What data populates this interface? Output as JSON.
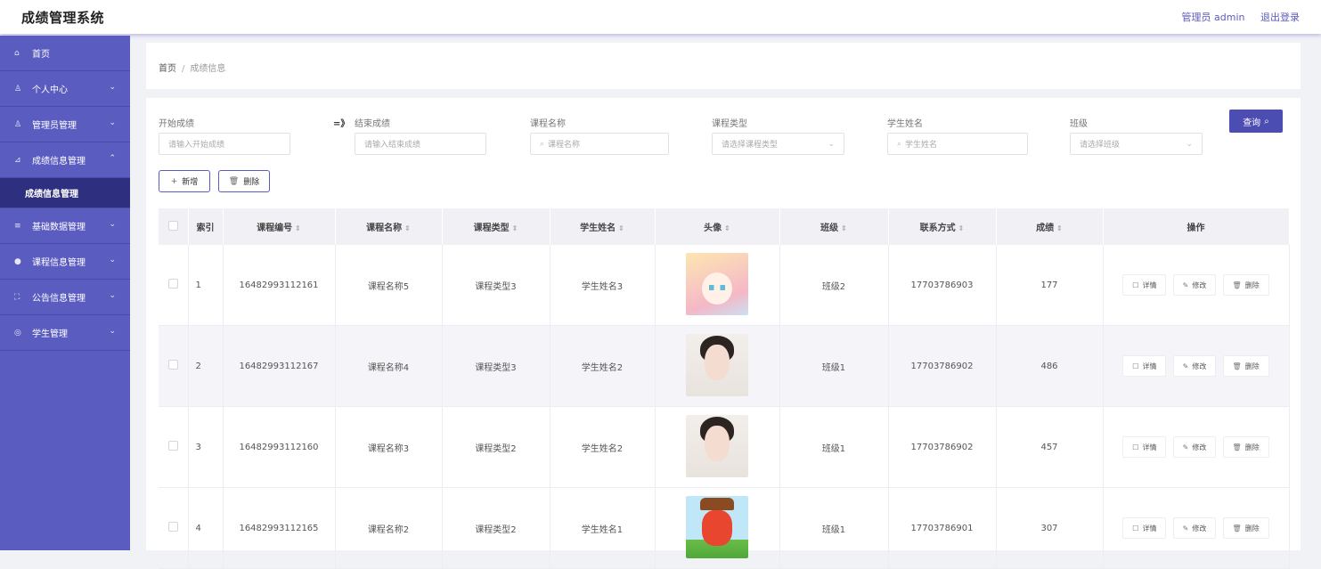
{
  "header": {
    "app_title": "成绩管理系统",
    "admin_label": "管理员 admin",
    "logout_label": "退出登录"
  },
  "sidebar": {
    "items": [
      {
        "label": "首页",
        "icon": "home-icon",
        "arrow": ""
      },
      {
        "label": "个人中心",
        "icon": "user-icon",
        "arrow": "⌄"
      },
      {
        "label": "管理员管理",
        "icon": "admin-icon",
        "arrow": "⌄"
      },
      {
        "label": "成绩信息管理",
        "icon": "chart-icon",
        "arrow": "⌃"
      },
      {
        "label": "基础数据管理",
        "icon": "database-icon",
        "arrow": "⌄"
      },
      {
        "label": "课程信息管理",
        "icon": "book-icon",
        "arrow": "⌄"
      },
      {
        "label": "公告信息管理",
        "icon": "notice-icon",
        "arrow": "⌄"
      },
      {
        "label": "学生管理",
        "icon": "student-icon",
        "arrow": "⌄"
      }
    ],
    "sub_item": "成绩信息管理"
  },
  "breadcrumb": {
    "home": "首页",
    "separator": "/",
    "current": "成绩信息"
  },
  "filters": {
    "start_score_label": "开始成绩",
    "start_score_placeholder": "请输入开始成绩",
    "range_arrow": "=》",
    "end_score_label": "结束成绩",
    "end_score_placeholder": "请输入结束成绩",
    "course_name_label": "课程名称",
    "course_name_placeholder": "课程名称",
    "course_type_label": "课程类型",
    "course_type_placeholder": "请选择课程类型",
    "student_name_label": "学生姓名",
    "student_name_placeholder": "学生姓名",
    "class_label": "班级",
    "class_placeholder": "请选择班级",
    "query_button": "查询"
  },
  "toolbar": {
    "add_label": "新增",
    "delete_label": "删除"
  },
  "table": {
    "columns": [
      "索引",
      "课程编号",
      "课程名称",
      "课程类型",
      "学生姓名",
      "头像",
      "班级",
      "联系方式",
      "成绩",
      "操作"
    ],
    "rows": [
      {
        "index": "1",
        "course_no": "16482993112161",
        "course_name": "课程名称5",
        "course_type": "课程类型3",
        "student": "学生姓名3",
        "avatar": "anime-girl-avatar",
        "class": "班级2",
        "phone": "17703786903",
        "score": "177"
      },
      {
        "index": "2",
        "course_no": "16482993112167",
        "course_name": "课程名称4",
        "course_type": "课程类型3",
        "student": "学生姓名2",
        "avatar": "woman-photo-avatar",
        "class": "班级1",
        "phone": "17703786902",
        "score": "486"
      },
      {
        "index": "3",
        "course_no": "16482993112160",
        "course_name": "课程名称3",
        "course_type": "课程类型2",
        "student": "学生姓名2",
        "avatar": "woman-photo-avatar",
        "class": "班级1",
        "phone": "17703786902",
        "score": "457"
      },
      {
        "index": "4",
        "course_no": "16482993112165",
        "course_name": "课程名称2",
        "course_type": "课程类型2",
        "student": "学生姓名1",
        "avatar": "cartoon-fox-avatar",
        "class": "班级1",
        "phone": "17703786901",
        "score": "307"
      }
    ],
    "actions": {
      "detail": "详情",
      "edit": "修改",
      "delete": "删除"
    }
  },
  "colors": {
    "sidebar_bg": "#5b5cc0",
    "sidebar_active": "#2e2f7e",
    "accent": "#4c4db3"
  }
}
